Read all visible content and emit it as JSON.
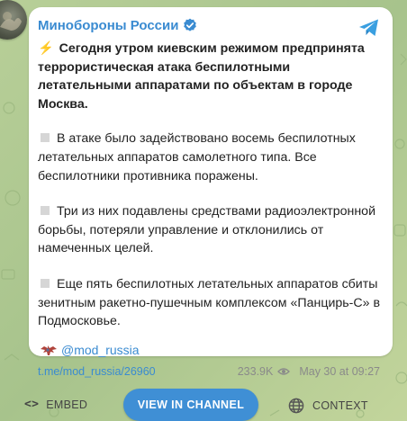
{
  "colors": {
    "background": "#a9c58e",
    "accent": "#3a8bd1",
    "button": "#3f8fd5"
  },
  "post": {
    "channel_name": "Минобороны России",
    "verified_icon": "verified-icon",
    "telegram_icon": "telegram-icon",
    "paragraphs": [
      {
        "icon": "⚡",
        "text": "Сегодня утром киевским режимом предпринята террористическая атака беспилотными летательными аппаратами по объектам в городе Москва."
      },
      {
        "icon": "square",
        "text": "В атаке было задействовано восемь беспилотных летательных аппаратов самолетного типа. Все беспилотники противника поражены."
      },
      {
        "icon": "square",
        "text": "Три из них подавлены средствами радиоэлектронной борьбы, потеряли управление и отклонились от намеченных целей."
      },
      {
        "icon": "square",
        "text": "Еще пять беспилотных летательных аппаратов сбиты зенитным ракетно-пушечным комплексом «Панцирь-С» в Подмосковье."
      }
    ],
    "signature": "@mod_russia",
    "link": "t.me/mod_russia/26960",
    "views": "233.9K",
    "date": "May 30 at 09:27"
  },
  "actions": {
    "embed": "EMBED",
    "view_channel": "VIEW IN CHANNEL",
    "context": "CONTEXT"
  }
}
